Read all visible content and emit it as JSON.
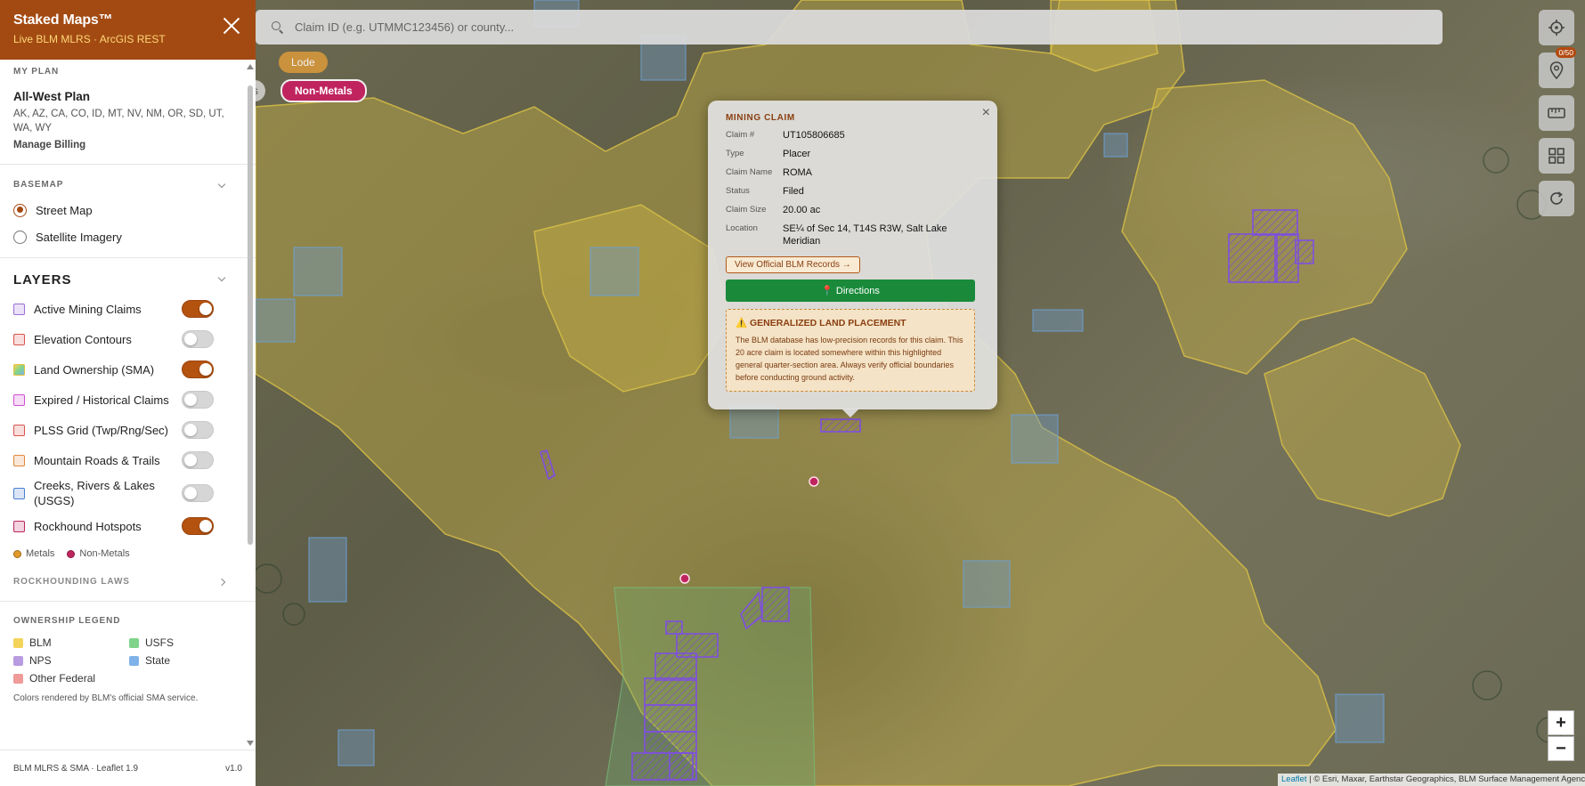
{
  "app": {
    "title": "Staked Maps™",
    "subtitle": "Live BLM MLRS · ArcGIS REST"
  },
  "plan": {
    "section_label": "MY PLAN",
    "name": "All-West Plan",
    "states": "AK, AZ, CA, CO, ID, MT, NV, NM, OR, SD, UT, WA, WY",
    "manage_label": "Manage Billing"
  },
  "basemap": {
    "section_label": "BASEMAP",
    "options": [
      {
        "label": "Street Map",
        "selected": true
      },
      {
        "label": "Satellite Imagery",
        "selected": false
      }
    ]
  },
  "layers": {
    "title": "LAYERS",
    "items": [
      {
        "label": "Active Mining Claims",
        "on": true,
        "color": "#9b6fd6"
      },
      {
        "label": "Elevation Contours",
        "on": false,
        "color": "#d9534f"
      },
      {
        "label": "Land Ownership (SMA)",
        "on": true,
        "color": "#e5c13a"
      },
      {
        "label": "Expired / Historical Claims",
        "on": false,
        "color": "#d04fd0"
      },
      {
        "label": "PLSS Grid (Twp/Rng/Sec)",
        "on": false,
        "color": "#d9534f"
      },
      {
        "label": "Mountain Roads & Trails",
        "on": false,
        "color": "#e0883a"
      },
      {
        "label": "Creeks, Rivers & Lakes (USGS)",
        "on": false,
        "color": "#4a7fd0"
      },
      {
        "label": "Rockhound Hotspots",
        "on": true,
        "color": "#c0245f"
      }
    ],
    "legend": {
      "metals": "Metals",
      "metals_color": "#e29a2a",
      "nonmetals": "Non-Metals",
      "nonmetals_color": "#c0245f"
    }
  },
  "rockhounding": {
    "label": "ROCKHOUNDING LAWS"
  },
  "ownership": {
    "section_label": "OWNERSHIP LEGEND",
    "items": [
      {
        "label": "BLM",
        "color": "#f3d35a"
      },
      {
        "label": "USFS",
        "color": "#7fd48a"
      },
      {
        "label": "NPS",
        "color": "#b89be0"
      },
      {
        "label": "State",
        "color": "#7fb2e8"
      },
      {
        "label": "Other Federal",
        "color": "#f09a9a"
      }
    ],
    "note": "Colors rendered by BLM's official SMA service."
  },
  "footer": {
    "left": "BLM MLRS & SMA · Leaflet 1.9",
    "right": "v1.0"
  },
  "search": {
    "placeholder": "Claim ID (e.g. UTMMC123456) or county..."
  },
  "chips": {
    "lode": "Lode",
    "partial": "s",
    "nonmetals": "Non-Metals"
  },
  "toolbar": {
    "badge": "0/50",
    "zoom_in": "+",
    "zoom_out": "−"
  },
  "attribution": {
    "leaflet": "Leaflet",
    "text": " | © Esri, Maxar, Earthstar Geographics, BLM Surface Management Agency"
  },
  "popup": {
    "title": "MINING CLAIM",
    "close": "×",
    "rows": [
      {
        "key": "Claim #",
        "value": "UT105806685"
      },
      {
        "key": "Type",
        "value": "Placer"
      },
      {
        "key": "Claim Name",
        "value": "ROMA"
      },
      {
        "key": "Status",
        "value": "Filed"
      },
      {
        "key": "Claim Size",
        "value": "20.00 ac"
      },
      {
        "key": "Location",
        "value": "SE¼ of Sec 14, T14S R3W, Salt Lake Meridian"
      }
    ],
    "blm_link": "View Official BLM Records →",
    "directions": "📍 Directions",
    "warning_title": "⚠️ GENERALIZED LAND PLACEMENT",
    "warning_body": "The BLM database has low-precision records for this claim. This 20 acre claim is located somewhere within this highlighted general quarter-section area. Always verify official boundaries before conducting ground activity."
  }
}
